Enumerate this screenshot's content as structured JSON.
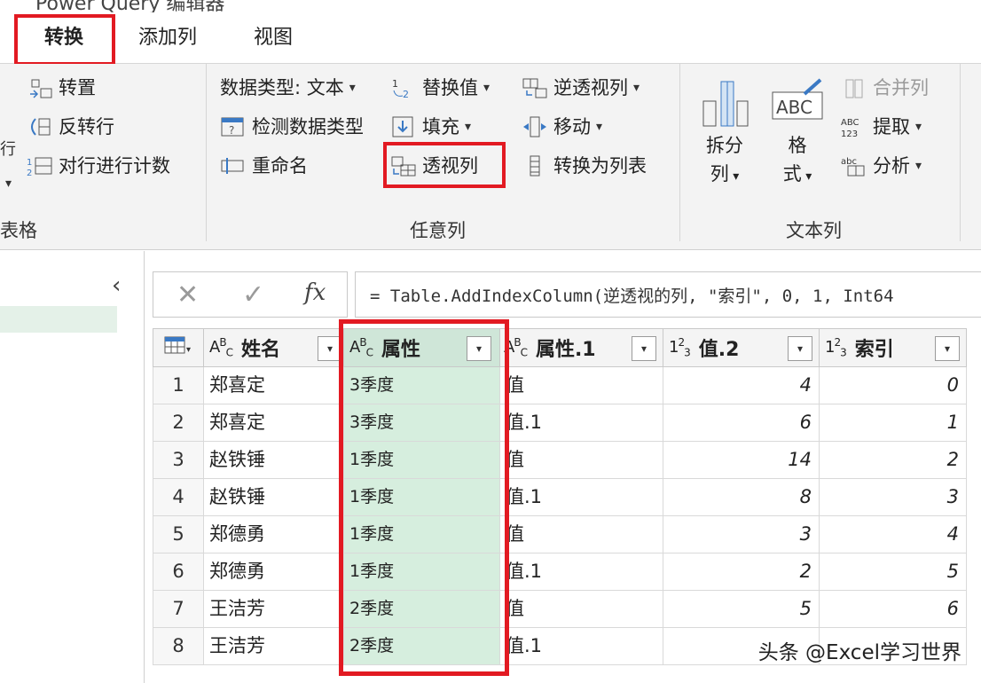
{
  "window": {
    "title": "Power Query 编辑器"
  },
  "tabs": [
    {
      "label": "转换"
    },
    {
      "label": "添加列"
    },
    {
      "label": "视图"
    }
  ],
  "ribbon": {
    "table_group": {
      "items": [
        "转置",
        "反转行",
        "对行进行计数"
      ],
      "label": "表格"
    },
    "any_column_group": {
      "data_type": "数据类型: 文本",
      "detect_type": "检测数据类型",
      "rename": "重命名",
      "replace_values": "替换值",
      "fill": "填充",
      "pivot_column": "透视列",
      "unpivot_columns": "逆透视列",
      "move": "移动",
      "convert_to_list": "转换为列表",
      "label": "任意列"
    },
    "text_column_group": {
      "split_column": [
        "拆分",
        "列"
      ],
      "format": [
        "格",
        "式"
      ],
      "merge_columns": "合并列",
      "extract": "提取",
      "parse": "分析",
      "label": "文本列"
    }
  },
  "formula_bar": {
    "cancel": "✕",
    "confirm": "✓",
    "fx": "fx",
    "formula": "= Table.AddIndexColumn(逆透视的列, \"索引\", 0, 1, Int64"
  },
  "table": {
    "columns": [
      {
        "type": "ABC",
        "name": "姓名"
      },
      {
        "type": "ABC",
        "name": "属性"
      },
      {
        "type": "ABC",
        "name": "属性.1"
      },
      {
        "type": "123",
        "name": "值.2"
      },
      {
        "type": "123",
        "name": "索引"
      }
    ],
    "rows": [
      {
        "n": "1",
        "name": "郑喜定",
        "attr": "3季度",
        "attr1": "值",
        "val": "4",
        "idx": "0"
      },
      {
        "n": "2",
        "name": "郑喜定",
        "attr": "3季度",
        "attr1": "值.1",
        "val": "6",
        "idx": "1"
      },
      {
        "n": "3",
        "name": "赵铁锤",
        "attr": "1季度",
        "attr1": "值",
        "val": "14",
        "idx": "2"
      },
      {
        "n": "4",
        "name": "赵铁锤",
        "attr": "1季度",
        "attr1": "值.1",
        "val": "8",
        "idx": "3"
      },
      {
        "n": "5",
        "name": "郑德勇",
        "attr": "1季度",
        "attr1": "值",
        "val": "3",
        "idx": "4"
      },
      {
        "n": "6",
        "name": "郑德勇",
        "attr": "1季度",
        "attr1": "值.1",
        "val": "2",
        "idx": "5"
      },
      {
        "n": "7",
        "name": "王洁芳",
        "attr": "2季度",
        "attr1": "值",
        "val": "5",
        "idx": "6"
      },
      {
        "n": "8",
        "name": "王洁芳",
        "attr": "2季度",
        "attr1": "值.1",
        "val": "",
        "idx": ""
      }
    ]
  },
  "watermark": "头条 @Excel学习世界",
  "colors": {
    "highlight": "#e21a22",
    "selected_column": "#d6eede",
    "accent": "#3a79c4"
  }
}
